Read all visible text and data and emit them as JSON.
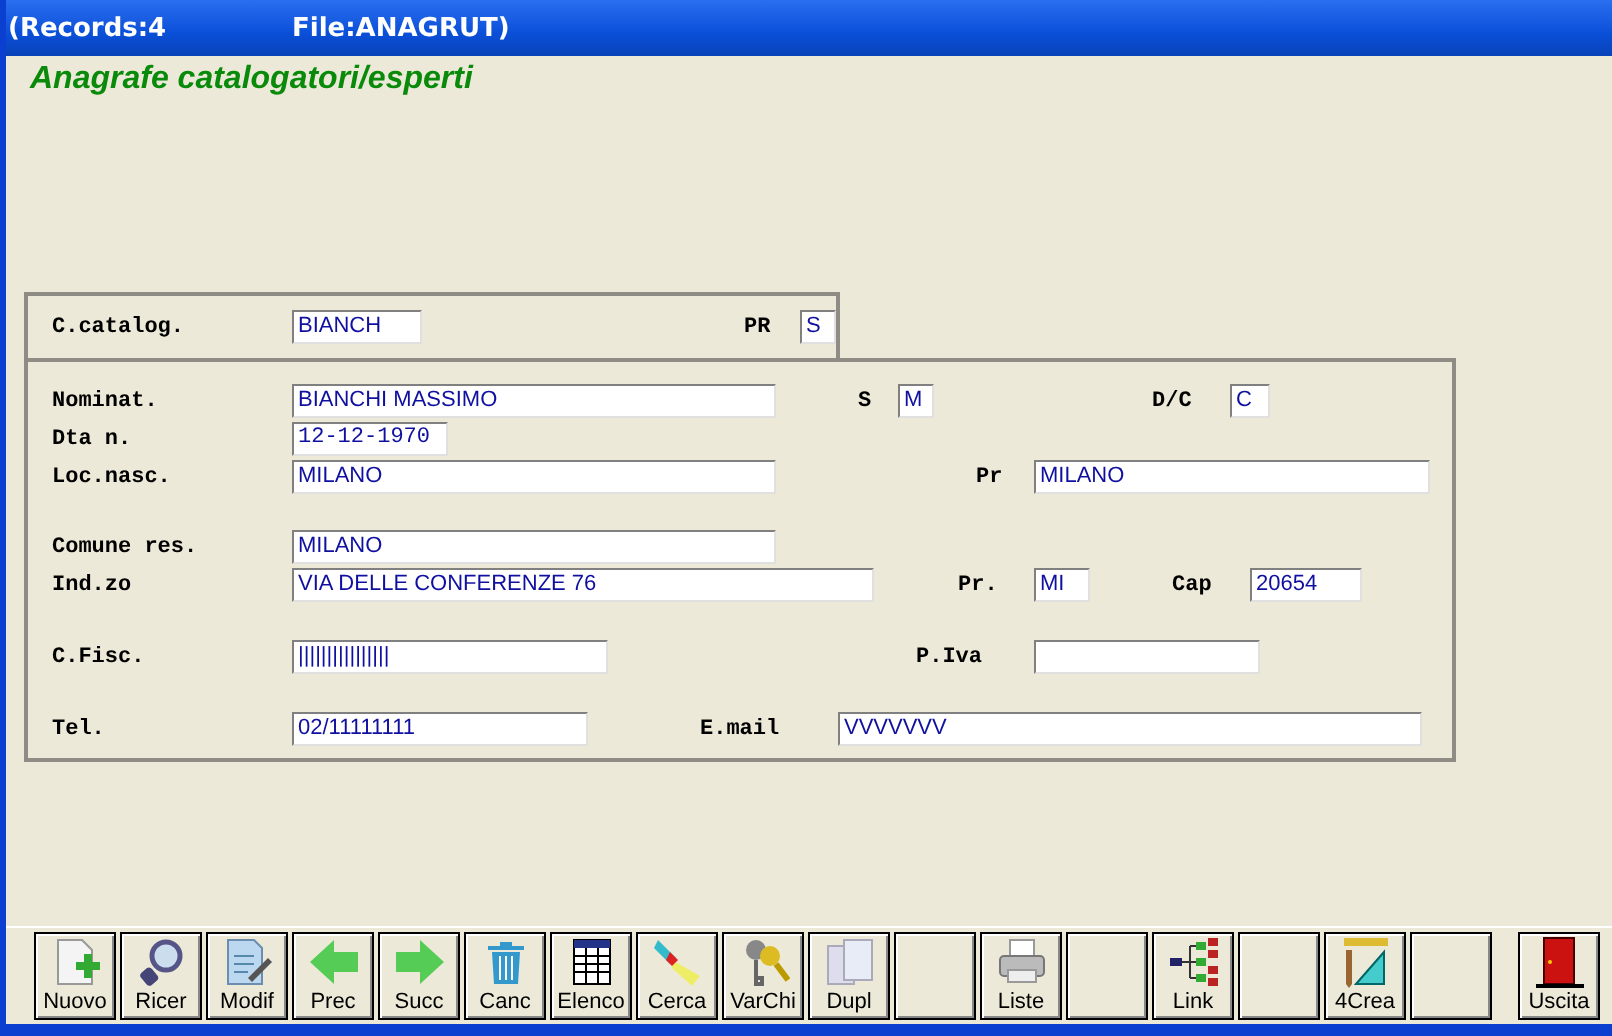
{
  "window": {
    "records": "(Records:4",
    "file": "File:ANAGRUT)"
  },
  "form_title": "Anagrafe catalogatori/esperti",
  "header_fields": [
    {
      "label": "C.catalog.",
      "value": "BIANCH"
    },
    {
      "label": "PR",
      "value": "S"
    }
  ],
  "rows": [
    [
      {
        "label": "Nominat.",
        "value": "BIANCHI MASSIMO"
      },
      {
        "label": "S",
        "value": "M"
      },
      {
        "label": "D/C",
        "value": "C"
      }
    ],
    [
      {
        "label": "Dta n.",
        "value": "12-12-1970"
      }
    ],
    [
      {
        "label": "Loc.nasc.",
        "value": "MILANO"
      },
      {
        "label": "Pr",
        "value": "MILANO"
      }
    ],
    [
      {
        "label": "Comune res.",
        "value": "MILANO"
      }
    ],
    [
      {
        "label": "Ind.zo",
        "value": "VIA DELLE CONFERENZE 76"
      },
      {
        "label": "Pr.",
        "value": "MI"
      },
      {
        "label": "Cap",
        "value": "20654"
      }
    ],
    [
      {
        "label": "C.Fisc.",
        "value": "||||||||||||||||"
      },
      {
        "label": "P.Iva"
      }
    ],
    [
      {
        "label": "Tel.",
        "value": "02/11111111"
      },
      {
        "label": "E.mail",
        "value": "VVVVVVV"
      }
    ]
  ],
  "toolbar": [
    {
      "kind": "new",
      "label": "Nuovo"
    },
    {
      "kind": "search",
      "label": "Ricer"
    },
    {
      "kind": "edit",
      "label": "Modif"
    },
    {
      "kind": "prev",
      "label": "Prec"
    },
    {
      "kind": "next",
      "label": "Succ"
    },
    {
      "kind": "delete",
      "label": "Canc"
    },
    {
      "kind": "list",
      "label": "Elenco"
    },
    {
      "kind": "find",
      "label": "Cerca"
    },
    {
      "kind": "keys",
      "label": "VarChi"
    },
    {
      "kind": "copy",
      "label": "Dupl"
    },
    {
      "kind": "blank"
    },
    {
      "kind": "print",
      "label": "Liste"
    },
    {
      "kind": "blank"
    },
    {
      "kind": "link",
      "label": "Link"
    },
    {
      "kind": "blank"
    },
    {
      "kind": "create",
      "label": "4Crea"
    },
    {
      "kind": "blank"
    },
    {
      "kind": "exit",
      "label": "Uscita"
    }
  ]
}
